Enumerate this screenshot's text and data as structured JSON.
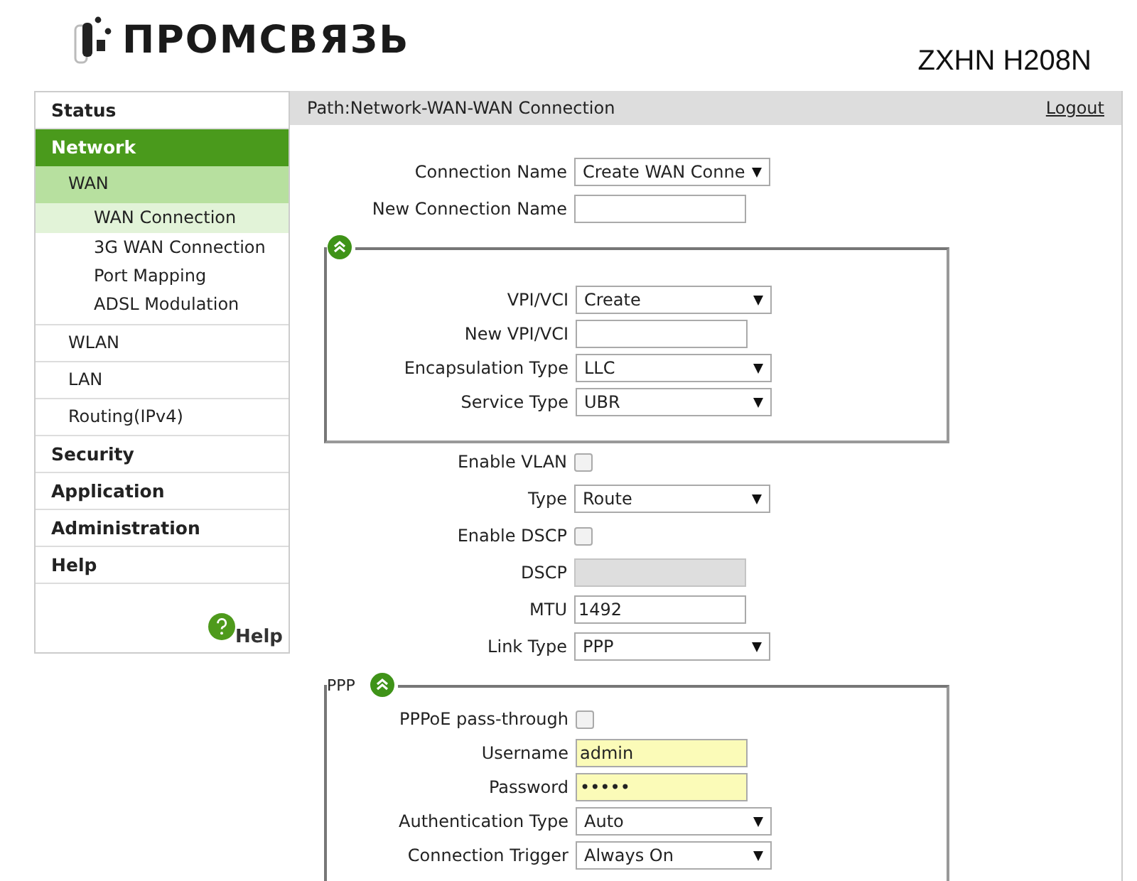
{
  "header": {
    "logo_text": "ПРОМСВЯЗЬ",
    "model": "ZXHN H208N"
  },
  "sidebar": {
    "items": [
      {
        "label": "Status",
        "selected": false
      },
      {
        "label": "Network",
        "selected": true,
        "children": [
          {
            "label": "WAN",
            "selected": true,
            "children": [
              {
                "label": "WAN Connection",
                "selected": true
              },
              {
                "label": "3G WAN Connection",
                "selected": false
              },
              {
                "label": "Port Mapping",
                "selected": false
              },
              {
                "label": "ADSL Modulation",
                "selected": false
              }
            ]
          },
          {
            "label": "WLAN",
            "selected": false
          },
          {
            "label": "LAN",
            "selected": false
          },
          {
            "label": "Routing(IPv4)",
            "selected": false
          }
        ]
      },
      {
        "label": "Security",
        "selected": false
      },
      {
        "label": "Application",
        "selected": false
      },
      {
        "label": "Administration",
        "selected": false
      },
      {
        "label": "Help",
        "selected": false
      }
    ],
    "help_link": "Help"
  },
  "path_bar": {
    "path": "Path:Network-WAN-WAN Connection",
    "logout": "Logout"
  },
  "form": [
    {
      "kind": "select",
      "label": "Connection Name",
      "value": "Create WAN Conne"
    },
    {
      "kind": "text",
      "label": "New Connection Name",
      "disabled": false,
      "autofilled": false
    },
    {
      "kind": "group",
      "expanded": true,
      "rows": [
        {
          "kind": "select",
          "label": "VPI/VCI",
          "value": "Create"
        },
        {
          "kind": "text",
          "label": "New VPI/VCI",
          "disabled": false,
          "autofilled": false
        },
        {
          "kind": "select",
          "label": "Encapsulation Type",
          "value": "LLC"
        },
        {
          "kind": "select",
          "label": "Service Type",
          "value": "UBR"
        }
      ]
    },
    {
      "kind": "checkbox",
      "label": "Enable VLAN",
      "checked": false
    },
    {
      "kind": "select",
      "label": "Type",
      "value": "Route"
    },
    {
      "kind": "checkbox",
      "label": "Enable DSCP",
      "checked": false
    },
    {
      "kind": "text",
      "label": "DSCP",
      "disabled": true,
      "autofilled": false
    },
    {
      "kind": "text",
      "label": "MTU",
      "value": "1492",
      "disabled": false,
      "autofilled": false
    },
    {
      "kind": "select",
      "label": "Link Type",
      "value": "PPP"
    },
    {
      "kind": "group",
      "legend": "PPP",
      "expanded": true,
      "rows": [
        {
          "kind": "checkbox",
          "label": "PPPoE pass-through",
          "checked": false
        },
        {
          "kind": "text",
          "label": "Username",
          "value": "admin",
          "disabled": false,
          "autofilled": true
        },
        {
          "kind": "text",
          "label": "Password",
          "value": "•••••",
          "disabled": false,
          "autofilled": true
        },
        {
          "kind": "select",
          "label": "Authentication Type",
          "value": "Auto"
        },
        {
          "kind": "select",
          "label": "Connection Trigger",
          "value": "Always On"
        }
      ]
    }
  ]
}
